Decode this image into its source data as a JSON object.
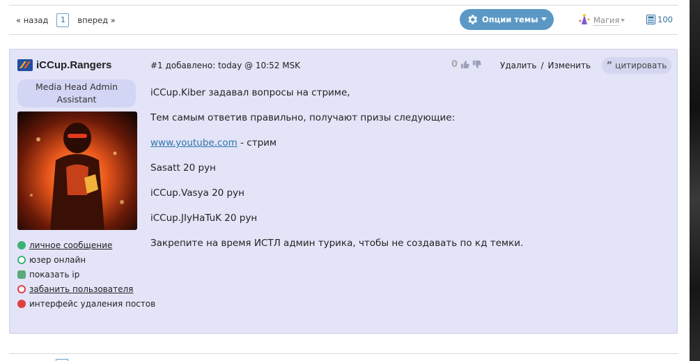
{
  "pager": {
    "prev_label": "« назад",
    "current_page": "1",
    "next_label": "вперед »"
  },
  "toolbar": {
    "options_label": "Опции темы",
    "magic_label": "Магия",
    "count": "100"
  },
  "post": {
    "author": "iCCup.Rangers",
    "rank_line1": "Media Head Admin",
    "rank_line2": "Assistant",
    "meta": "#1 добавлено: today @ 10:52 MSK",
    "votes": "0",
    "delete_label": "Удалить",
    "separator": "/",
    "edit_label": "Изменить",
    "quote_label": "цитировать",
    "user_links": [
      {
        "label": "личное сообщение",
        "icon": "message-icon",
        "color": "#3cb371"
      },
      {
        "label": "юзер онлайн",
        "icon": "online-icon",
        "color": "#3cb371"
      },
      {
        "label": "показать ip",
        "icon": "ip-icon",
        "color": "#5aa97a"
      },
      {
        "label": "забанить пользователя",
        "icon": "ban-icon",
        "color": "#e04040"
      },
      {
        "label": "интерфейс удаления постов",
        "icon": "delete-posts-icon",
        "color": "#e04040"
      }
    ],
    "lines": [
      "iCCup.Kiber задавал вопросы на стриме,",
      "Тем самым ответив правильно, получают призы следующие:",
      "- стрим",
      "Sasatt 20 рун",
      "iCCup.Vasya 20 рун",
      "iCCup.JIyHaTuK 20 рун",
      "Закрепите на время ИСТЛ админ турика, чтобы не создавать по кд темки."
    ],
    "link_text": "www.youtube.com"
  },
  "colors": {
    "accent": "#5b98c6",
    "post_bg": "#e3e4f8",
    "link": "#2f74a8"
  }
}
